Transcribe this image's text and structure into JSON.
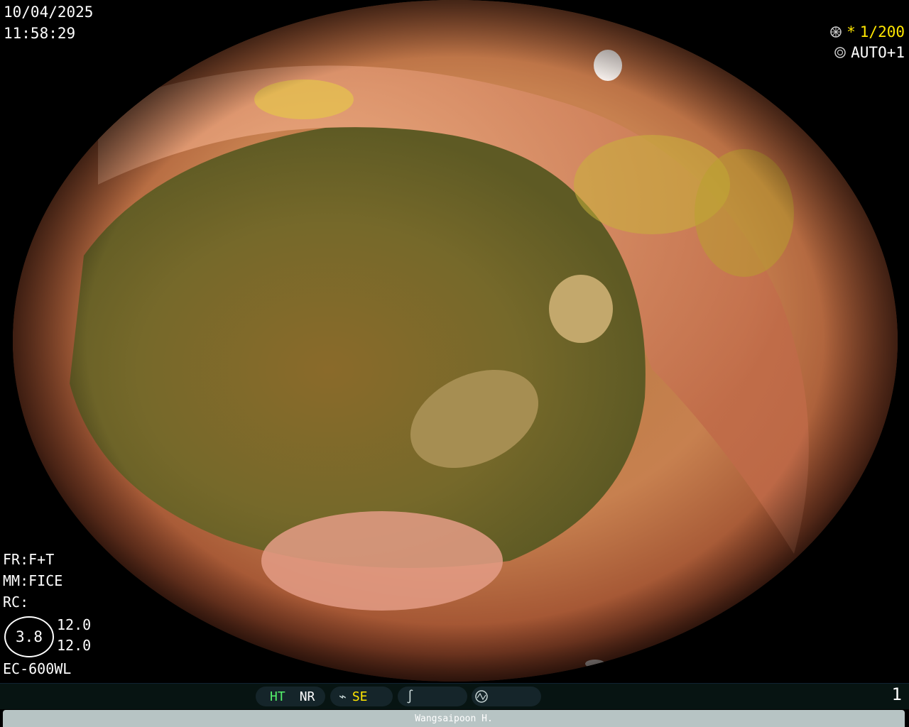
{
  "overlay": {
    "date": "10/04/2025",
    "time": "11:58:29",
    "shutter_symbol": "*",
    "shutter_value": "1/200",
    "iris_value": "AUTO+1",
    "fr": "FR:F+T",
    "mm": "MM:FICE",
    "rc": "RC:",
    "oval_value": "3.8",
    "value_top": "12.0",
    "value_bottom": "12.0",
    "model": "EC-600WL"
  },
  "status_bar": {
    "ht": "HT",
    "nr": "NR",
    "se": "SE",
    "page_number": "1"
  },
  "footer": {
    "operator": "Wangsaipoon H."
  },
  "icons": [
    "shutter-icon",
    "iris-icon",
    "se-wave-icon",
    "curve-icon",
    "circle-wave-icon"
  ],
  "colors": {
    "background": "#000000",
    "accent_yellow": "#ffe600",
    "accent_green": "#54f06a",
    "footer_bar": "#b7c4c4"
  }
}
